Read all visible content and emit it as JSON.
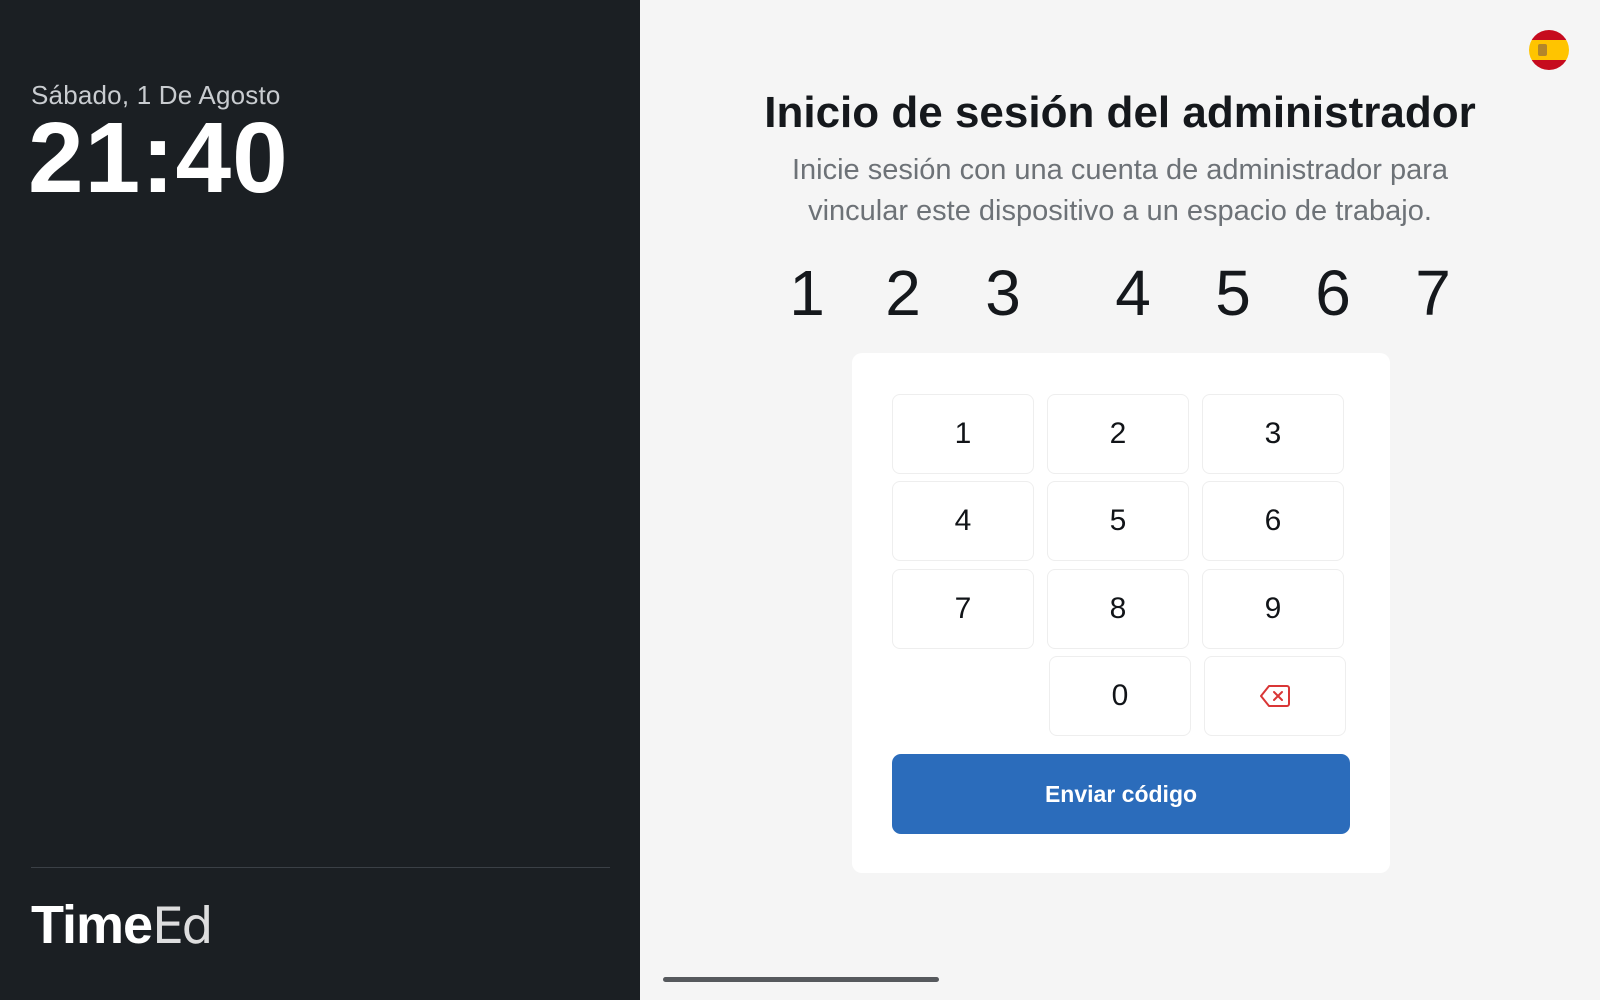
{
  "left_panel": {
    "date": "Sábado, 1 De Agosto",
    "time": "21:40",
    "brand": {
      "bold": "Time",
      "light": "Ed"
    }
  },
  "header": {
    "language_flag": "spain-flag-icon",
    "title": "Inicio de sesión del administrador",
    "subtitle": "Inicie sesión con una cuenta de administrador para vincular este dispositivo a un espacio de trabajo."
  },
  "code": {
    "digits": [
      "1",
      "2",
      "3",
      "4",
      "5",
      "6",
      "7"
    ]
  },
  "keypad": {
    "keys": [
      "1",
      "2",
      "3",
      "4",
      "5",
      "6",
      "7",
      "8",
      "9",
      "0"
    ],
    "backspace_icon": "backspace-icon",
    "submit_label": "Enviar código"
  },
  "colors": {
    "left_bg": "#1b1f23",
    "right_bg": "#f5f5f5",
    "accent": "#2b6cbb",
    "delete_red": "#d93636"
  }
}
